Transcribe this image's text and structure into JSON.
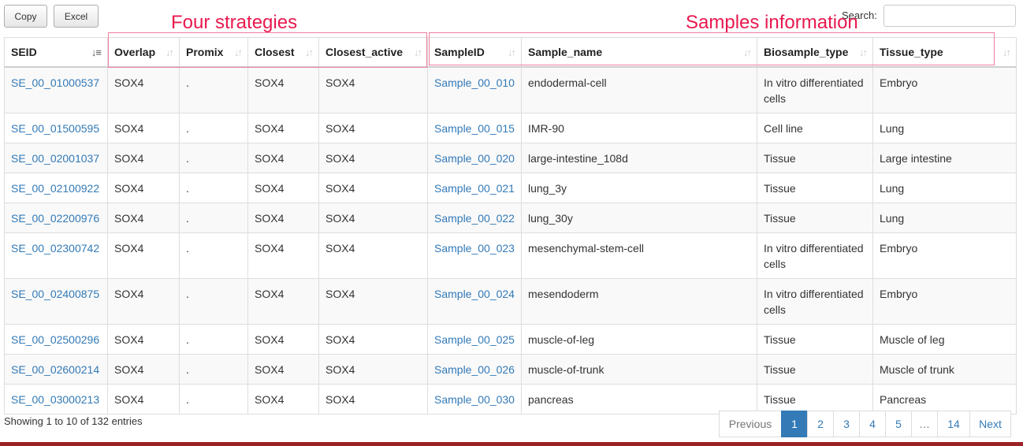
{
  "toolbar": {
    "copy_label": "Copy",
    "excel_label": "Excel"
  },
  "search": {
    "label": "Search:",
    "value": "",
    "placeholder": ""
  },
  "annotations": {
    "four_strategies": "Four strategies",
    "samples_information": "Samples information",
    "color": "#e8194e"
  },
  "table": {
    "headers": [
      "SEID",
      "Overlap",
      "Promix",
      "Closest",
      "Closest_active",
      "SampleID",
      "Sample_name",
      "Biosample_type",
      "Tissue_type"
    ],
    "rows": [
      [
        "SE_00_01000537",
        "SOX4",
        ".",
        "SOX4",
        "SOX4",
        "Sample_00_010",
        "endodermal-cell",
        "In vitro differentiated cells",
        "Embryo"
      ],
      [
        "SE_00_01500595",
        "SOX4",
        ".",
        "SOX4",
        "SOX4",
        "Sample_00_015",
        "IMR-90",
        "Cell line",
        "Lung"
      ],
      [
        "SE_00_02001037",
        "SOX4",
        ".",
        "SOX4",
        "SOX4",
        "Sample_00_020",
        "large-intestine_108d",
        "Tissue",
        "Large intestine"
      ],
      [
        "SE_00_02100922",
        "SOX4",
        ".",
        "SOX4",
        "SOX4",
        "Sample_00_021",
        "lung_3y",
        "Tissue",
        "Lung"
      ],
      [
        "SE_00_02200976",
        "SOX4",
        ".",
        "SOX4",
        "SOX4",
        "Sample_00_022",
        "lung_30y",
        "Tissue",
        "Lung"
      ],
      [
        "SE_00_02300742",
        "SOX4",
        ".",
        "SOX4",
        "SOX4",
        "Sample_00_023",
        "mesenchymal-stem-cell",
        "In vitro differentiated cells",
        "Embryo"
      ],
      [
        "SE_00_02400875",
        "SOX4",
        ".",
        "SOX4",
        "SOX4",
        "Sample_00_024",
        "mesendoderm",
        "In vitro differentiated cells",
        "Embryo"
      ],
      [
        "SE_00_02500296",
        "SOX4",
        ".",
        "SOX4",
        "SOX4",
        "Sample_00_025",
        "muscle-of-leg",
        "Tissue",
        "Muscle of leg"
      ],
      [
        "SE_00_02600214",
        "SOX4",
        ".",
        "SOX4",
        "SOX4",
        "Sample_00_026",
        "muscle-of-trunk",
        "Tissue",
        "Muscle of trunk"
      ],
      [
        "SE_00_03000213",
        "SOX4",
        ".",
        "SOX4",
        "SOX4",
        "Sample_00_030",
        "pancreas",
        "Tissue",
        "Pancreas"
      ]
    ]
  },
  "info": "Showing 1 to 10 of 132 entries",
  "pagination": {
    "previous": "Previous",
    "pages": [
      "1",
      "2",
      "3",
      "4",
      "5",
      "…",
      "14"
    ],
    "current": "1",
    "next": "Next"
  },
  "colors": {
    "link": "#337ab7",
    "accent_bar": "#9b2226",
    "annotation": "#e8194e"
  }
}
